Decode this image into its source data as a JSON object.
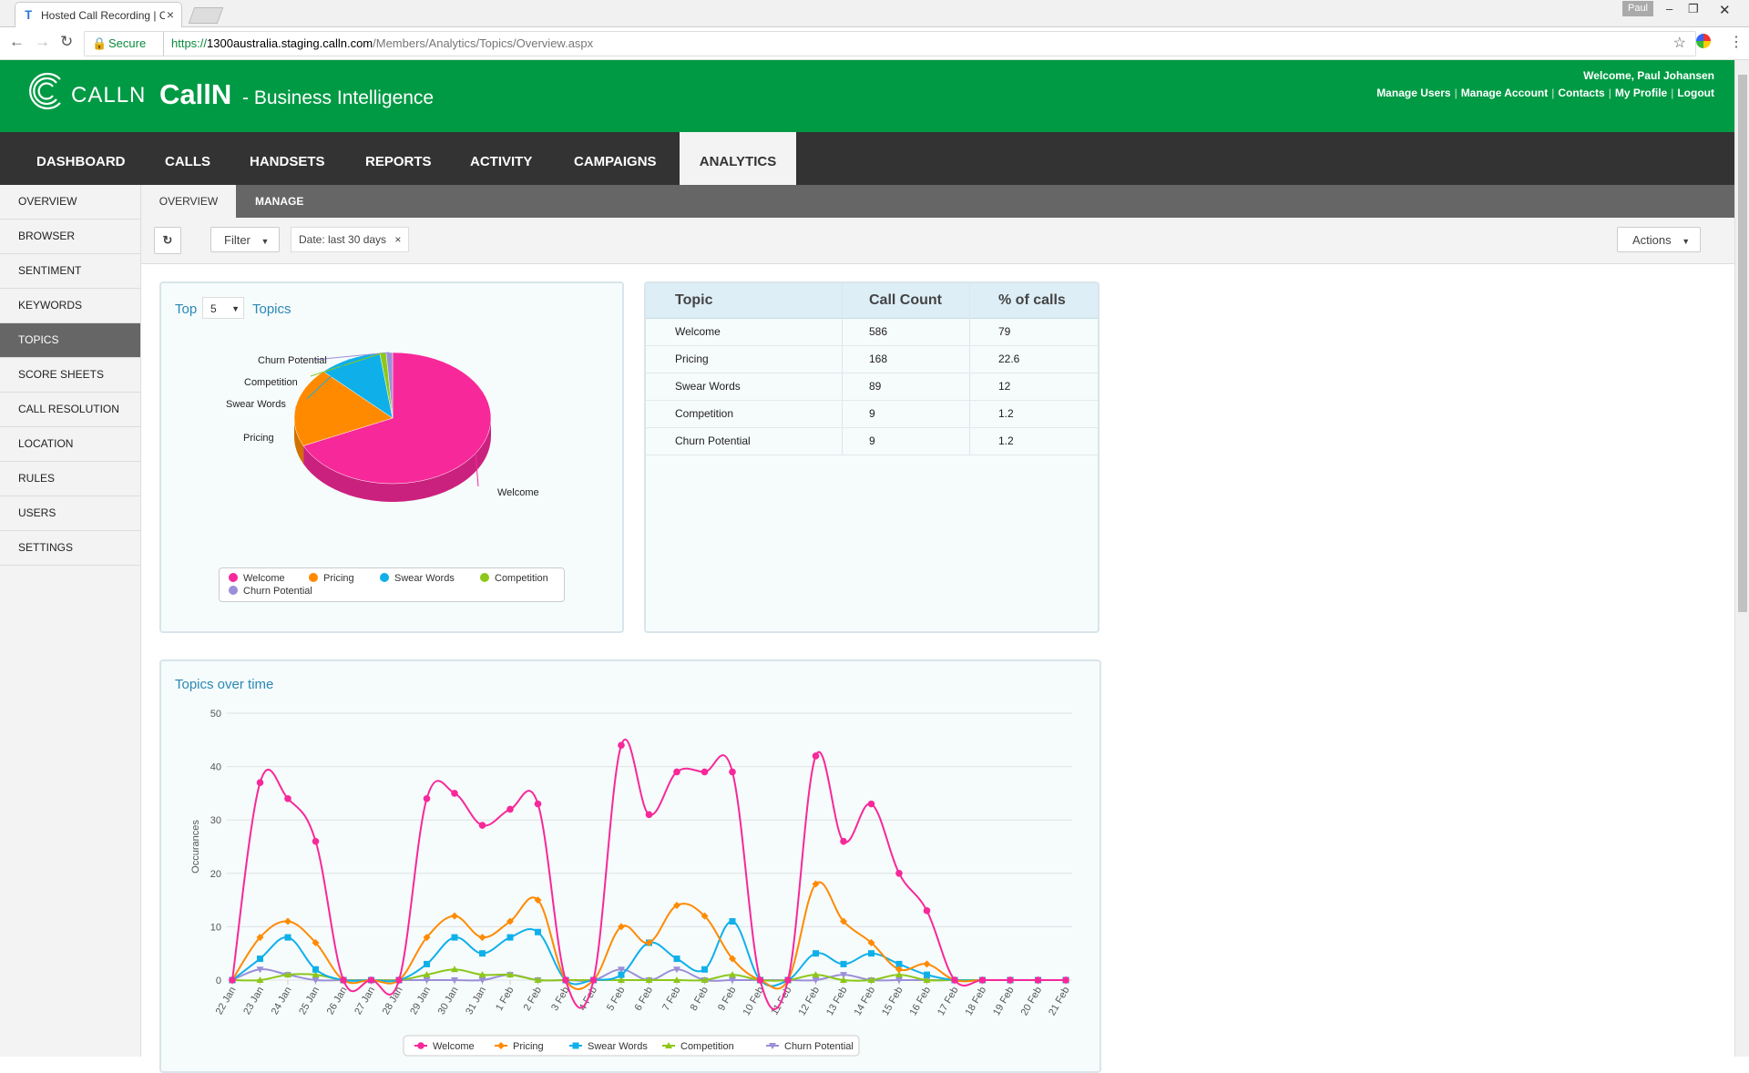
{
  "browser": {
    "tab_title": "Hosted Call Recording | C",
    "secure_label": "Secure",
    "url_scheme": "https://",
    "url_host": "1300australia.staging.calln.com",
    "url_path": "/Members/Analytics/Topics/Overview.aspx",
    "profile_name": "Paul"
  },
  "header": {
    "logo_text": "CALLN",
    "title": "CallN",
    "subtitle": "- Business Intelligence",
    "welcome": "Welcome, Paul Johansen",
    "links": [
      "Manage Users",
      "Manage Account",
      "Contacts",
      "My Profile",
      "Logout"
    ]
  },
  "main_nav": [
    "DASHBOARD",
    "CALLS",
    "HANDSETS",
    "REPORTS",
    "ACTIVITY",
    "CAMPAIGNS",
    "ANALYTICS"
  ],
  "main_nav_active": "ANALYTICS",
  "sidebar": [
    "OVERVIEW",
    "BROWSER",
    "SENTIMENT",
    "KEYWORDS",
    "TOPICS",
    "SCORE SHEETS",
    "CALL RESOLUTION",
    "LOCATION",
    "RULES",
    "USERS",
    "SETTINGS"
  ],
  "sidebar_active": "TOPICS",
  "sub_nav": [
    "OVERVIEW",
    "MANAGE"
  ],
  "toolbar": {
    "filter_label": "Filter",
    "date_chip": "Date: last 30 days",
    "actions_label": "Actions"
  },
  "topics_panel": {
    "title_prefix": "Top",
    "top_count": "5",
    "title_suffix": "Topics"
  },
  "topic_table": {
    "headers": [
      "Topic",
      "Call Count",
      "% of calls"
    ],
    "rows": [
      [
        "Welcome",
        "586",
        "79"
      ],
      [
        "Pricing",
        "168",
        "22.6"
      ],
      [
        "Swear Words",
        "89",
        "12"
      ],
      [
        "Competition",
        "9",
        "1.2"
      ],
      [
        "Churn Potential",
        "9",
        "1.2"
      ]
    ]
  },
  "colors": {
    "Welcome": "#f7289a",
    "Pricing": "#ff8a00",
    "Swear Words": "#0fb0ea",
    "Competition": "#8cc71a",
    "Churn Potential": "#9a8fd8",
    "brand_green": "#009a44"
  },
  "chart_data": [
    {
      "type": "pie",
      "labels": [
        "Welcome",
        "Pricing",
        "Swear Words",
        "Competition",
        "Churn Potential"
      ],
      "values": [
        586,
        168,
        89,
        9,
        9
      ]
    },
    {
      "type": "line",
      "title": "Topics over time",
      "ylabel": "Occurances",
      "ylim": [
        0,
        50
      ],
      "yticks": [
        0,
        10,
        20,
        30,
        40,
        50
      ],
      "categories": [
        "22 Jan",
        "23 Jan",
        "24 Jan",
        "25 Jan",
        "26 Jan",
        "27 Jan",
        "28 Jan",
        "29 Jan",
        "30 Jan",
        "31 Jan",
        "1 Feb",
        "2 Feb",
        "3 Feb",
        "4 Feb",
        "5 Feb",
        "6 Feb",
        "7 Feb",
        "8 Feb",
        "9 Feb",
        "10 Feb",
        "11 Feb",
        "12 Feb",
        "13 Feb",
        "14 Feb",
        "15 Feb",
        "16 Feb",
        "17 Feb",
        "18 Feb",
        "19 Feb",
        "20 Feb",
        "21 Feb"
      ],
      "x_half_steps": [
        0,
        1,
        2,
        3,
        4,
        6,
        8,
        10,
        12,
        14,
        16,
        18,
        20,
        22,
        24,
        25,
        26,
        27,
        28,
        29,
        30,
        31,
        32,
        33,
        34,
        35,
        36,
        37,
        38,
        39,
        40,
        41,
        42,
        43,
        44,
        45,
        46,
        47,
        48,
        49,
        50,
        52,
        54,
        56,
        58,
        60
      ],
      "series": [
        {
          "name": "Welcome",
          "values": [
            0,
            37,
            34,
            26,
            0,
            0,
            0,
            34,
            35,
            29,
            32,
            33,
            0,
            0,
            44,
            31,
            39,
            39,
            39,
            0,
            0,
            42,
            26,
            33,
            20,
            13,
            0,
            0,
            0,
            0,
            0
          ],
          "marker": "circle"
        },
        {
          "name": "Pricing",
          "values": [
            0,
            8,
            11,
            7,
            0,
            0,
            0,
            8,
            12,
            8,
            11,
            15,
            0,
            0,
            10,
            7,
            14,
            12,
            4,
            0,
            0,
            18,
            11,
            7,
            2,
            3,
            0,
            0,
            0,
            0,
            0
          ],
          "marker": "diamond"
        },
        {
          "name": "Swear Words",
          "values": [
            0,
            4,
            8,
            2,
            0,
            0,
            0,
            3,
            8,
            5,
            8,
            9,
            0,
            0,
            1,
            7,
            4,
            2,
            11,
            0,
            0,
            5,
            3,
            5,
            3,
            1,
            0,
            0,
            0,
            0,
            0
          ],
          "marker": "square"
        },
        {
          "name": "Competition",
          "values": [
            0,
            0,
            1,
            1,
            0,
            0,
            0,
            1,
            2,
            1,
            1,
            0,
            0,
            0,
            0,
            0,
            0,
            0,
            1,
            0,
            0,
            1,
            0,
            0,
            1,
            0,
            0,
            0,
            0,
            0,
            0
          ],
          "marker": "triangle"
        },
        {
          "name": "Churn Potential",
          "values": [
            0,
            2,
            1,
            0,
            0,
            0,
            0,
            0,
            0,
            0,
            1,
            0,
            0,
            0,
            2,
            0,
            2,
            0,
            0,
            0,
            0,
            0,
            1,
            0,
            0,
            0,
            0,
            0,
            0,
            0,
            0
          ],
          "marker": "triangle-down"
        }
      ]
    }
  ]
}
